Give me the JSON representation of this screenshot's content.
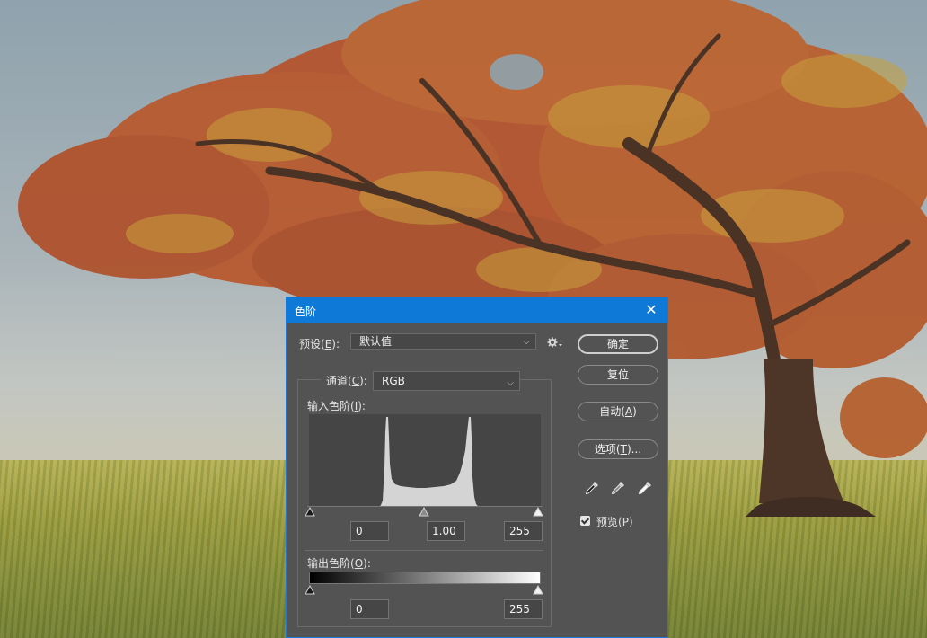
{
  "dialog": {
    "title": "色阶",
    "close_glyph": "✕",
    "preset": {
      "label": "预设(",
      "key": "E",
      "suffix": "):",
      "value": "默认值"
    },
    "channel": {
      "label": "通道(",
      "key": "C",
      "suffix": "):",
      "value": "RGB"
    },
    "input_levels": {
      "label": "输入色阶(",
      "key": "I",
      "suffix": "):",
      "black": "0",
      "gamma": "1.00",
      "white": "255"
    },
    "output_levels": {
      "label": "输出色阶(",
      "key": "O",
      "suffix": "):",
      "black": "0",
      "white": "255"
    },
    "buttons": {
      "ok": "确定",
      "reset": "复位",
      "auto": {
        "label": "自动(",
        "key": "A",
        "suffix": ")"
      },
      "options": {
        "label": "选项(",
        "key": "T",
        "suffix": ")..."
      }
    },
    "preview": {
      "label": "预览(",
      "key": "P",
      "suffix": ")",
      "checked": true
    },
    "icons": [
      "gear-icon",
      "chevron-down-icon",
      "black-eyedropper-icon",
      "gray-eyedropper-icon",
      "white-eyedropper-icon",
      "close-icon"
    ],
    "colors": {
      "titlebar": "#0f79d8",
      "panel": "#535353",
      "histogram_bg": "#454545",
      "histogram_fill": "#d4d4d4"
    }
  }
}
